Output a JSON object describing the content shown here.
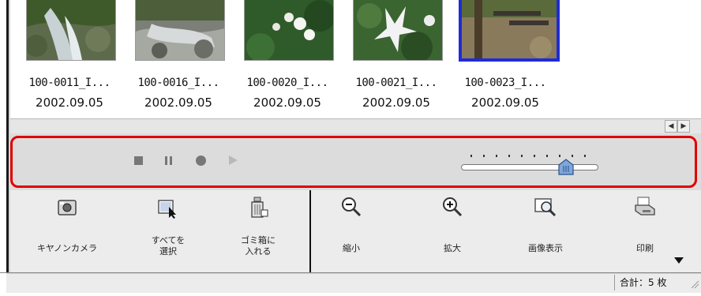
{
  "thumbnails": [
    {
      "name": "100-0011_I...",
      "date": "2002.09.05",
      "selected": false
    },
    {
      "name": "100-0016_I...",
      "date": "2002.09.05",
      "selected": false
    },
    {
      "name": "100-0020_I...",
      "date": "2002.09.05",
      "selected": false
    },
    {
      "name": "100-0021_I...",
      "date": "2002.09.05",
      "selected": false
    },
    {
      "name": "100-0023_I...",
      "date": "2002.09.05",
      "selected": true
    }
  ],
  "scroll": {
    "left_icon": "arrow-left-icon",
    "right_icon": "arrow-right-icon",
    "left_glyph": "◀",
    "right_glyph": "▶"
  },
  "player": {
    "controls": [
      "stop-icon",
      "pause-icon",
      "record-icon",
      "play-icon"
    ],
    "slider_value": 0.78
  },
  "toolbar": {
    "left": [
      {
        "label": "キヤノンカメラ",
        "icon": "camera-icon"
      },
      {
        "label_1": "すべてを",
        "label_2": "選択",
        "icon": "select-all-icon"
      },
      {
        "label_1": "ゴミ箱に",
        "label_2": "入れる",
        "icon": "trash-icon"
      }
    ],
    "right": [
      {
        "label": "縮小",
        "icon": "zoom-out-icon"
      },
      {
        "label": "拡大",
        "icon": "zoom-in-icon"
      },
      {
        "label": "画像表示",
        "icon": "view-image-icon"
      },
      {
        "label": "印刷",
        "icon": "print-icon"
      }
    ],
    "more_icon": "dropdown-triangle-icon"
  },
  "status": {
    "total": "合計：5 枚"
  },
  "colors": {
    "highlight": "#e00000",
    "selection": "#1e2bd8"
  }
}
